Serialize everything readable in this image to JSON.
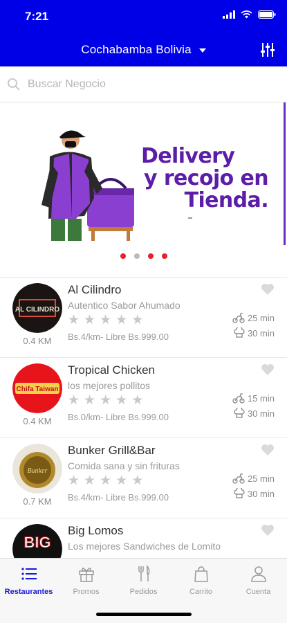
{
  "status": {
    "time": "7:21"
  },
  "header": {
    "city": "Cochabamba Bolivia",
    "filter_icon": "sliders-icon"
  },
  "search": {
    "placeholder": "Buscar Negocio"
  },
  "banner": {
    "line1": "Delivery",
    "line2": "y recojo en",
    "line3": "Tienda.",
    "dots_total": 4,
    "active_index": 1,
    "accent": "#5c1ea8"
  },
  "restaurants": [
    {
      "name": "Al Cilindro",
      "description": "Autentico Sabor Ahumado",
      "distance": "0.4 KM",
      "fee": "Bs.4/km- Libre Bs.999.00",
      "time1": "25 min",
      "time2": "30 min",
      "logo_text": "AL CILINDRO"
    },
    {
      "name": "Tropical Chicken",
      "description": "los mejores pollitos",
      "distance": "0.4 KM",
      "fee": "Bs.0/km- Libre Bs.999.00",
      "time1": "15 min",
      "time2": "30 min",
      "logo_text": "Chifa Taiwan"
    },
    {
      "name": "Bunker Grill&Bar",
      "description": "Comida sana y sin frituras",
      "distance": "0.7 KM",
      "fee": "Bs.4/km- Libre Bs.999.00",
      "time1": "25 min",
      "time2": "30 min",
      "logo_text": "Bunker"
    },
    {
      "name": "Big Lomos",
      "description": "Los mejores Sandwiches de Lomito",
      "distance": "",
      "fee": "",
      "time1": "",
      "time2": "",
      "logo_text": "BIG"
    }
  ],
  "tabs": [
    {
      "label": "Restaurantes",
      "icon": "list-icon",
      "active": true
    },
    {
      "label": "Promos",
      "icon": "gift-icon",
      "active": false
    },
    {
      "label": "Pedidos",
      "icon": "utensils-icon",
      "active": false
    },
    {
      "label": "Carrito",
      "icon": "bag-icon",
      "active": false
    },
    {
      "label": "Cuenta",
      "icon": "user-icon",
      "active": false
    }
  ],
  "colors": {
    "header": "#0000e6",
    "active_tab": "#1a1ad8",
    "dot_active": "#e8202a"
  }
}
